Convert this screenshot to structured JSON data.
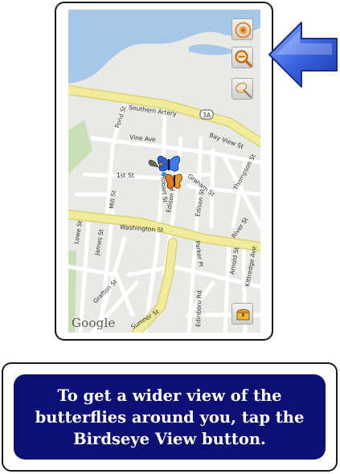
{
  "map": {
    "streets": {
      "southern_artery": "Southern Artery",
      "route_badge": "3A",
      "pond_st": "Pond St",
      "vine_ave": "Vine Ave",
      "bay_view_st": "Bay View St",
      "first_st": "1st St",
      "hobart_st": "Hobart St",
      "edison_park": "Edison Park",
      "edison_st": "Edison St",
      "graham_st": "Graham St",
      "thompson_st": "Thompson St",
      "mill_st": "Mill St",
      "washington_st": "Washington St",
      "river_st": "River St",
      "lowe_st": "Lowe St",
      "james_st": "James St",
      "parker_pl": "Parker Pl",
      "arnold_st": "Arnold St",
      "kittredge_ave": "Kittredge Ave",
      "grafton_st": "Grafton St",
      "edinboro_rd": "Edinboro Rd",
      "sumner_st": "Sumner St"
    },
    "attribution": "Google",
    "controls": [
      {
        "name": "locate",
        "icon": "target-icon"
      },
      {
        "name": "birdseye-view",
        "icon": "zoom-out-magnifier-icon"
      },
      {
        "name": "butterfly-net",
        "icon": "net-icon"
      },
      {
        "name": "collection",
        "icon": "treasure-chest-icon"
      }
    ]
  },
  "callout": {
    "text": "To get a wider view of the butterflies around you, tap the Birdseye View button."
  },
  "colors": {
    "water": "#a6c7e8",
    "highway": "#f0ec9a",
    "callout_bg": "#0c1075",
    "arrow": "#3a63e0"
  }
}
